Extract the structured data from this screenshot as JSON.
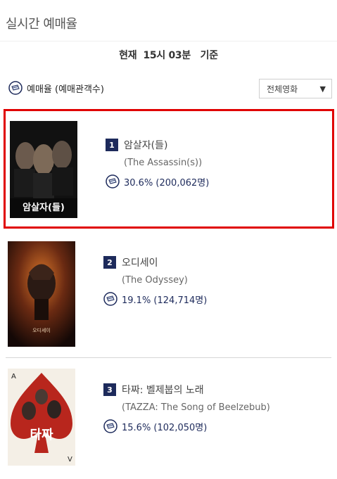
{
  "header": {
    "title": "실시간 예매율"
  },
  "timestamp": {
    "text": "현재  15시 03분   기준"
  },
  "legend": {
    "label": "예매율 (예매관객수)",
    "icon": "ticket-icon"
  },
  "filter": {
    "selected": "전체영화",
    "icon": "dropdown-arrow-icon",
    "arrow": "▼"
  },
  "movies": [
    {
      "rank": "1",
      "title": "암살자(들)",
      "english_title": "(The Assassin(s))",
      "rate": "30.6% (200,062명)",
      "poster_text": "암살자(들)"
    },
    {
      "rank": "2",
      "title": "오디세이",
      "english_title": "(The Odyssey)",
      "rate": "19.1% (124,714명)",
      "poster_text": "오디세이"
    },
    {
      "rank": "3",
      "title": "타짜: 벨제붑의 노래",
      "english_title": "(TAZZA: The Song of Beelzebub)",
      "rate": "15.6% (102,050명)",
      "poster_text": "타짜"
    }
  ],
  "colors": {
    "badge": "#1d2a5b",
    "highlight": "#e00000"
  }
}
